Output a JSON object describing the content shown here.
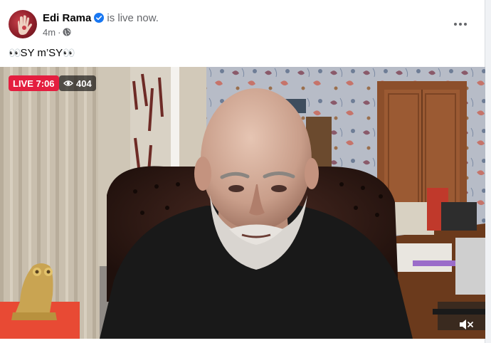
{
  "post": {
    "author": "Edi Rama",
    "status_text": "is live now.",
    "timestamp": "4m",
    "meta_separator": "·",
    "caption_eyes_left": "👀",
    "caption_text": "SY m’SY",
    "caption_eyes_right": "👀"
  },
  "video": {
    "live_label": "LIVE 7:06",
    "viewer_count": "404"
  },
  "icons": {
    "verified": "verified-badge-icon",
    "audience": "globe-icon",
    "more": "more-options-icon",
    "viewers": "eye-icon",
    "volume": "muted-volume-icon"
  },
  "colors": {
    "live_red": "#e41e3f",
    "verified_blue": "#1877f2",
    "secondary_text": "#65676b"
  }
}
